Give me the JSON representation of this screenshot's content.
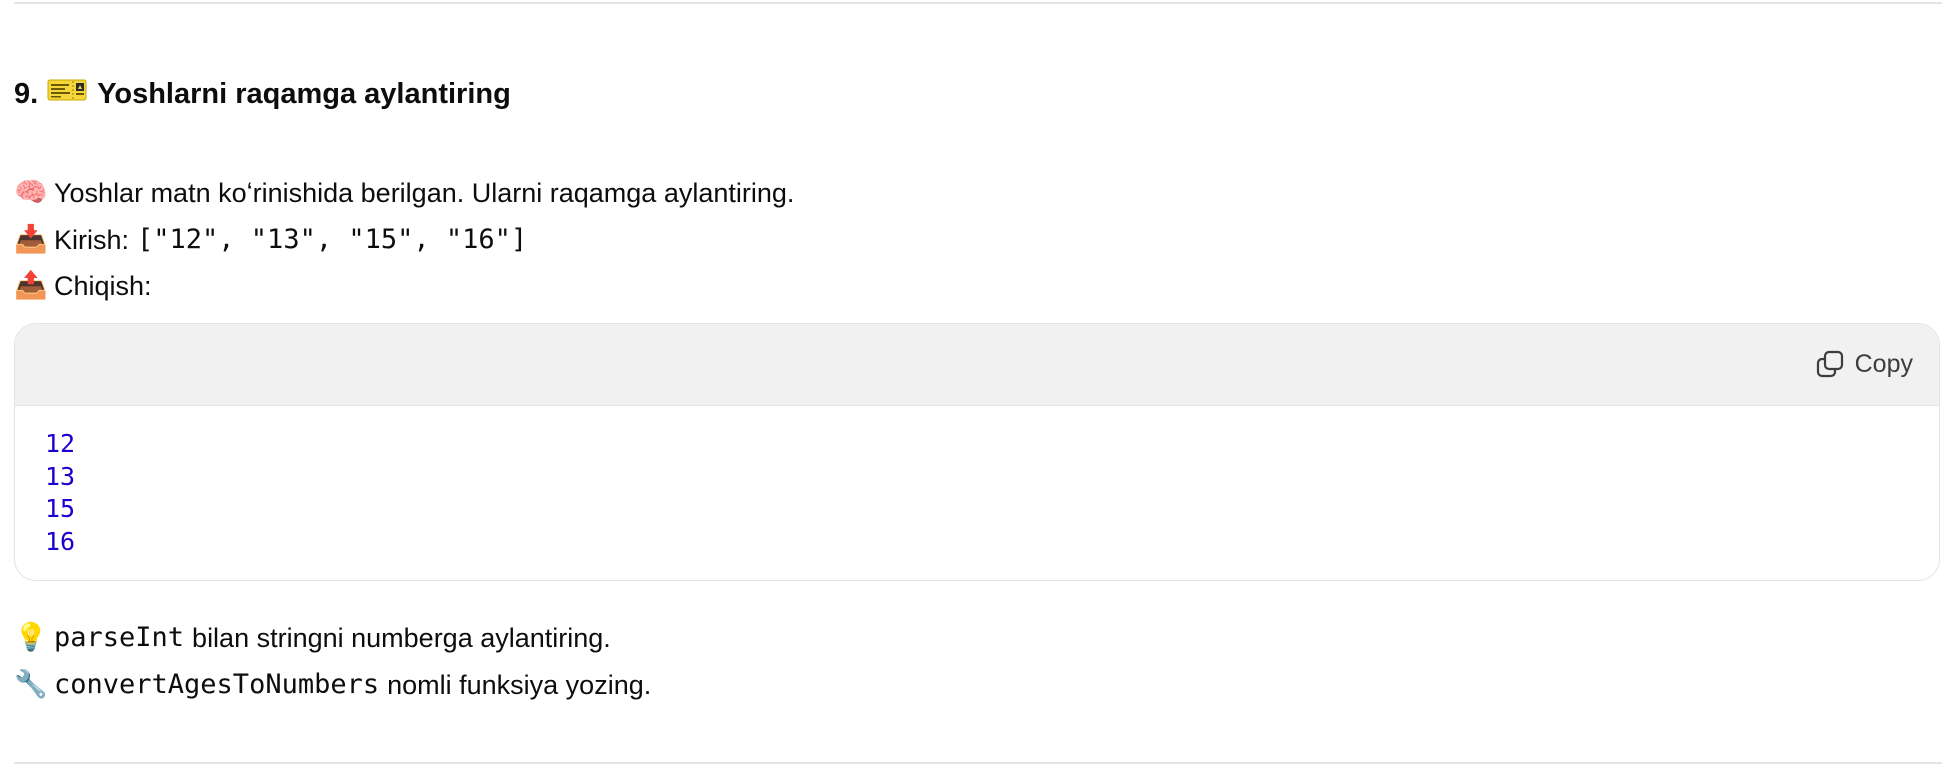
{
  "heading": {
    "number": "9.",
    "emoji": "🎫",
    "title": "Yoshlarni raqamga aylantiring"
  },
  "description": {
    "emoji": "🧠",
    "text": "Yoshlar matn koʻrinishida berilgan. Ularni raqamga aylantiring."
  },
  "input": {
    "emoji": "📥",
    "label": "Kirish:",
    "value": "[\"12\", \"13\", \"15\", \"16\"]"
  },
  "output": {
    "emoji": "📤",
    "label": "Chiqish:"
  },
  "code_block": {
    "copy_label": "Copy",
    "copy_icon": "copy-icon",
    "lines": [
      "12",
      "13",
      "15",
      "16"
    ],
    "number_color": "#1c00cf",
    "header_bg": "#f1f1f1"
  },
  "hint": {
    "emoji": "💡",
    "code": "parseInt",
    "text": "bilan stringni numberga aylantiring."
  },
  "task": {
    "emoji": "🔧",
    "code": "convertAgesToNumbers",
    "text": "nomli funksiya yozing."
  }
}
